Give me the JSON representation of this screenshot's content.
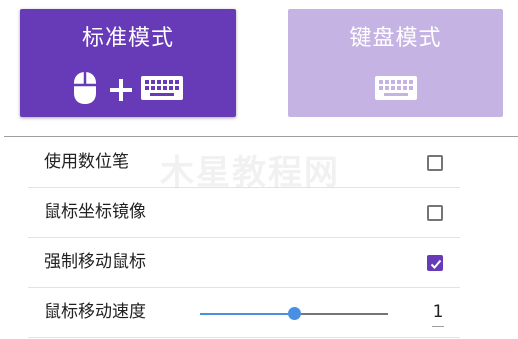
{
  "modes": {
    "standard": {
      "label": "标准模式",
      "icons": [
        "mouse-icon",
        "plus-icon",
        "keyboard-icon"
      ],
      "active": true
    },
    "keyboard": {
      "label": "键盘模式",
      "icons": [
        "keyboard-icon"
      ],
      "active": false
    }
  },
  "watermark": "木星教程网",
  "settings": {
    "use_pen": {
      "label": "使用数位笔",
      "checked": false
    },
    "mirror": {
      "label": "鼠标坐标镜像",
      "checked": false
    },
    "force_move": {
      "label": "强制移动鼠标",
      "checked": true
    },
    "speed": {
      "label": "鼠标移动速度",
      "value": "1",
      "slider_fraction": 0.5
    }
  },
  "colors": {
    "accent": "#673ab7",
    "accent_light": "#c5b3e3",
    "slider": "#4a90e2"
  }
}
